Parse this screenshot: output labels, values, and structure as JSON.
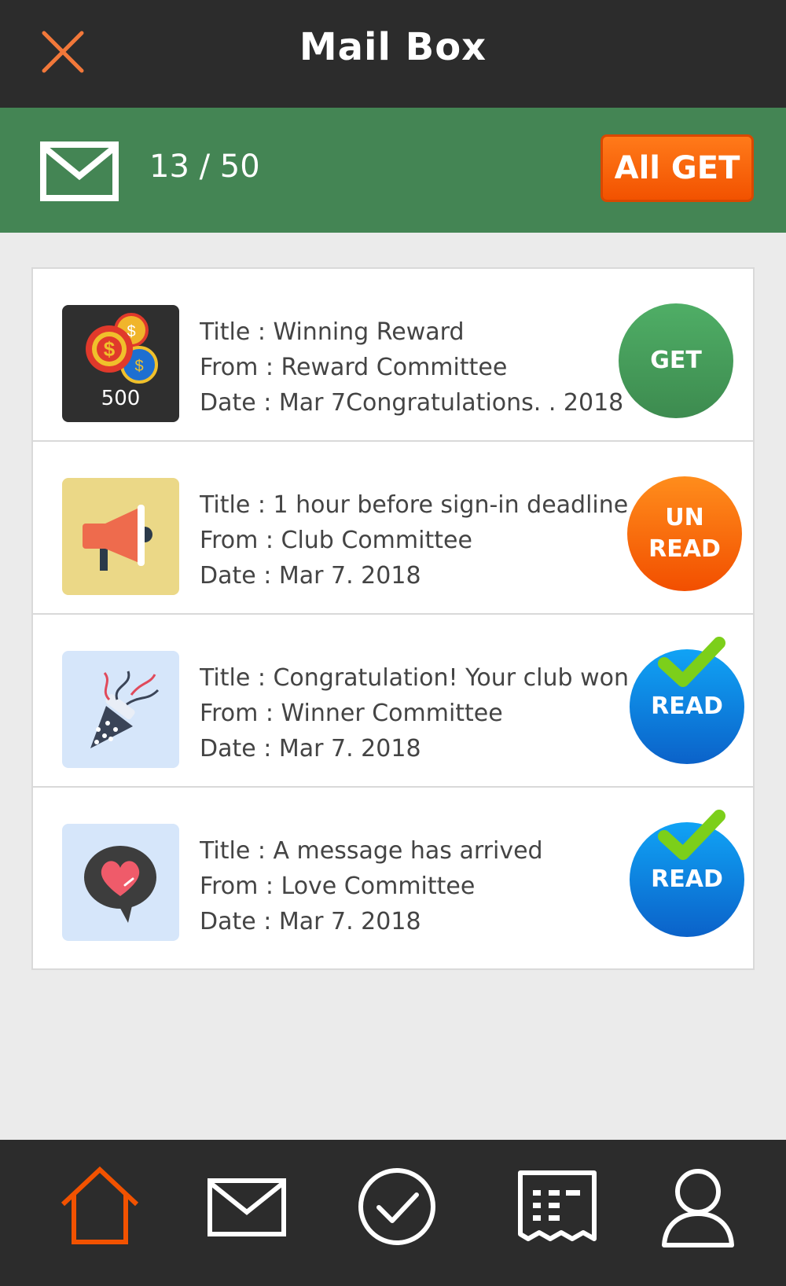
{
  "header": {
    "title": "Mail Box",
    "close_icon": "close-x-icon"
  },
  "status": {
    "mail_icon": "envelope-icon",
    "count_text": "13 / 50",
    "all_get_label": "All GET"
  },
  "mails": [
    {
      "title": "Title : Winning Reward",
      "from": "From : Reward Committee",
      "date": "Date : Mar 7Congratulations. . 2018",
      "thumb_icon": "casino-chips-icon",
      "thumb_caption": "500",
      "action_label": "GET",
      "action_state": "get"
    },
    {
      "title": "Title : 1 hour before sign-in deadline",
      "from": "From : Club Committee",
      "date": "Date : Mar 7. 2018",
      "thumb_icon": "megaphone-icon",
      "action_label_line1": "UN",
      "action_label_line2": "READ",
      "action_state": "unread"
    },
    {
      "title": "Title : Congratulation! Your club won",
      "from": "From : Winner Committee",
      "date": "Date : Mar 7. 2018",
      "thumb_icon": "party-popper-icon",
      "action_label": "READ",
      "action_state": "read"
    },
    {
      "title": "Title : A message has arrived",
      "from": "From : Love Committee",
      "date": "Date : Mar 7. 2018",
      "thumb_icon": "heart-message-icon",
      "action_label": "READ",
      "action_state": "read"
    }
  ],
  "nav": {
    "items": [
      {
        "icon": "home-icon",
        "active": true
      },
      {
        "icon": "mail-icon",
        "active": false
      },
      {
        "icon": "check-circle-icon",
        "active": false
      },
      {
        "icon": "ticket-list-icon",
        "active": false
      },
      {
        "icon": "user-icon",
        "active": false
      }
    ]
  },
  "colors": {
    "header_bg": "#2c2c2c",
    "status_bg": "#448554",
    "accent_orange": "#f25200",
    "get_green": "#3d8b4f",
    "read_blue": "#0b62c9",
    "check_green": "#7ccf1a"
  }
}
